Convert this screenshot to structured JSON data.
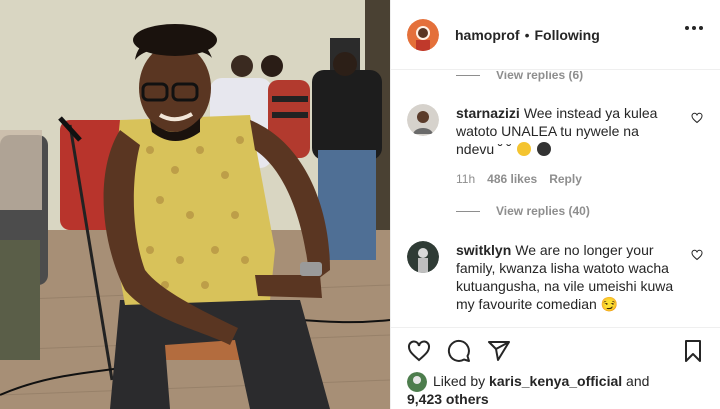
{
  "header": {
    "username": "hamoprof",
    "separator": "•",
    "follow_state": "Following",
    "more_icon": "more-horizontal-icon"
  },
  "comments": {
    "top_replies": "View replies (6)",
    "items": [
      {
        "username": "starnazizi",
        "text": "Wee instead ya kulea watoto UNALEA tu nywele na ndevu",
        "emoji_text": "˘ ˘",
        "age": "11h",
        "likes": "486 likes",
        "reply": "Reply",
        "replies": "View replies (40)"
      },
      {
        "username": "switklyn",
        "text": "We are no longer your family, kwanza lisha watoto wacha kutuangusha, na vile umeishi kuwa my favourite comedian",
        "emoji_text": "😏"
      }
    ]
  },
  "actions": {
    "like_icon": "heart-icon",
    "comment_icon": "comment-icon",
    "share_icon": "send-icon",
    "save_icon": "bookmark-icon"
  },
  "likes": {
    "prefix": "Liked by",
    "user": "karis_kenya_official",
    "connector": "and",
    "others": "9,423 others"
  },
  "colors": {
    "text": "#262626",
    "muted": "#8e8e8e",
    "border": "#efefef"
  }
}
